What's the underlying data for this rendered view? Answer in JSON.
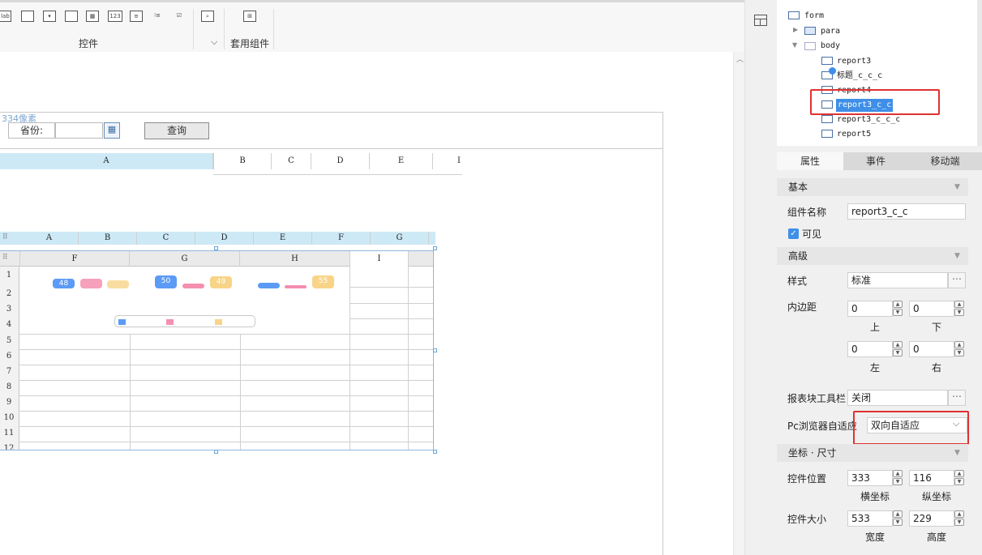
{
  "toolbar": {
    "widget_label": "控件",
    "composite_label": "套用组件",
    "icon_lab_text": "lab",
    "icon_123_text": "123",
    "expand_icon": "chevron-down-icon"
  },
  "canvas": {
    "size_hint": "334像素",
    "query_label": "省份:",
    "query_button": "查询",
    "outer_columns": [
      "A",
      "B",
      "C",
      "D",
      "E",
      "I"
    ],
    "inner_top_columns": [
      "A",
      "B",
      "C",
      "D",
      "E",
      "F",
      "G"
    ],
    "inner_columns": [
      "F",
      "G",
      "H",
      "I"
    ],
    "rows": [
      "1",
      "2",
      "3",
      "4",
      "5",
      "6",
      "7",
      "8",
      "9",
      "10",
      "11",
      "12"
    ],
    "pills": [
      "48",
      "",
      "",
      "50",
      "",
      "49",
      "",
      "",
      "55"
    ]
  },
  "tree": {
    "root": "form",
    "para": "para",
    "body": "body",
    "items": [
      "report3",
      "标题_c_c_c",
      "report4",
      "report3_c_c",
      "report3_c_c_c",
      "report5"
    ],
    "selected": "report3_c_c"
  },
  "tabs": [
    "属性",
    "事件",
    "移动端"
  ],
  "props": {
    "basic_section": "基本",
    "name_label": "组件名称",
    "name_value": "report3_c_c",
    "visible_label": "可见",
    "advanced_section": "高级",
    "style_label": "样式",
    "style_value": "标准",
    "padding_label": "内边距",
    "pad_top": "0",
    "pad_bottom": "0",
    "pad_left": "0",
    "pad_right": "0",
    "top_label": "上",
    "bottom_label": "下",
    "left_label": "左",
    "right_label": "右",
    "toolbar_label": "报表块工具栏",
    "toolbar_value": "关闭",
    "pc_adapt_label": "Pc浏览器自适应",
    "pc_adapt_value": "双向自适应",
    "coord_section": "坐标 · 尺寸",
    "pos_label": "控件位置",
    "pos_x": "333",
    "pos_y": "116",
    "x_label": "横坐标",
    "y_label": "纵坐标",
    "size_label": "控件大小",
    "width": "533",
    "height": "229",
    "width_label": "宽度",
    "height_label": "高度"
  },
  "colors": {
    "accent": "#3f8fe8",
    "highlight_red": "#e03131",
    "pill_blue": "#5b9bf5",
    "pill_pink": "#f58fb0",
    "pill_yellow": "#f8d488"
  }
}
